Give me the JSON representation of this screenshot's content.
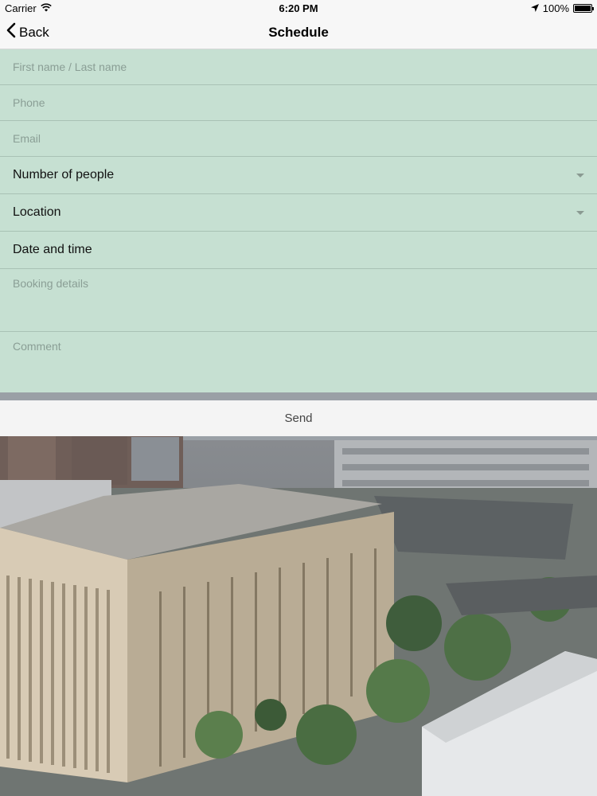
{
  "status_bar": {
    "carrier": "Carrier",
    "time": "6:20 PM",
    "battery_percent": "100%",
    "battery_level": 1.0
  },
  "nav": {
    "back_label": "Back",
    "title": "Schedule"
  },
  "form": {
    "name_placeholder": "First name / Last name",
    "phone_placeholder": "Phone",
    "email_placeholder": "Email",
    "people_label": "Number of people",
    "location_label": "Location",
    "datetime_label": "Date and time",
    "booking_placeholder": "Booking details",
    "comment_placeholder": "Comment"
  },
  "actions": {
    "send_label": "Send"
  },
  "colors": {
    "form_background": "#c6e0d2",
    "bar_background": "#f7f7f7"
  }
}
